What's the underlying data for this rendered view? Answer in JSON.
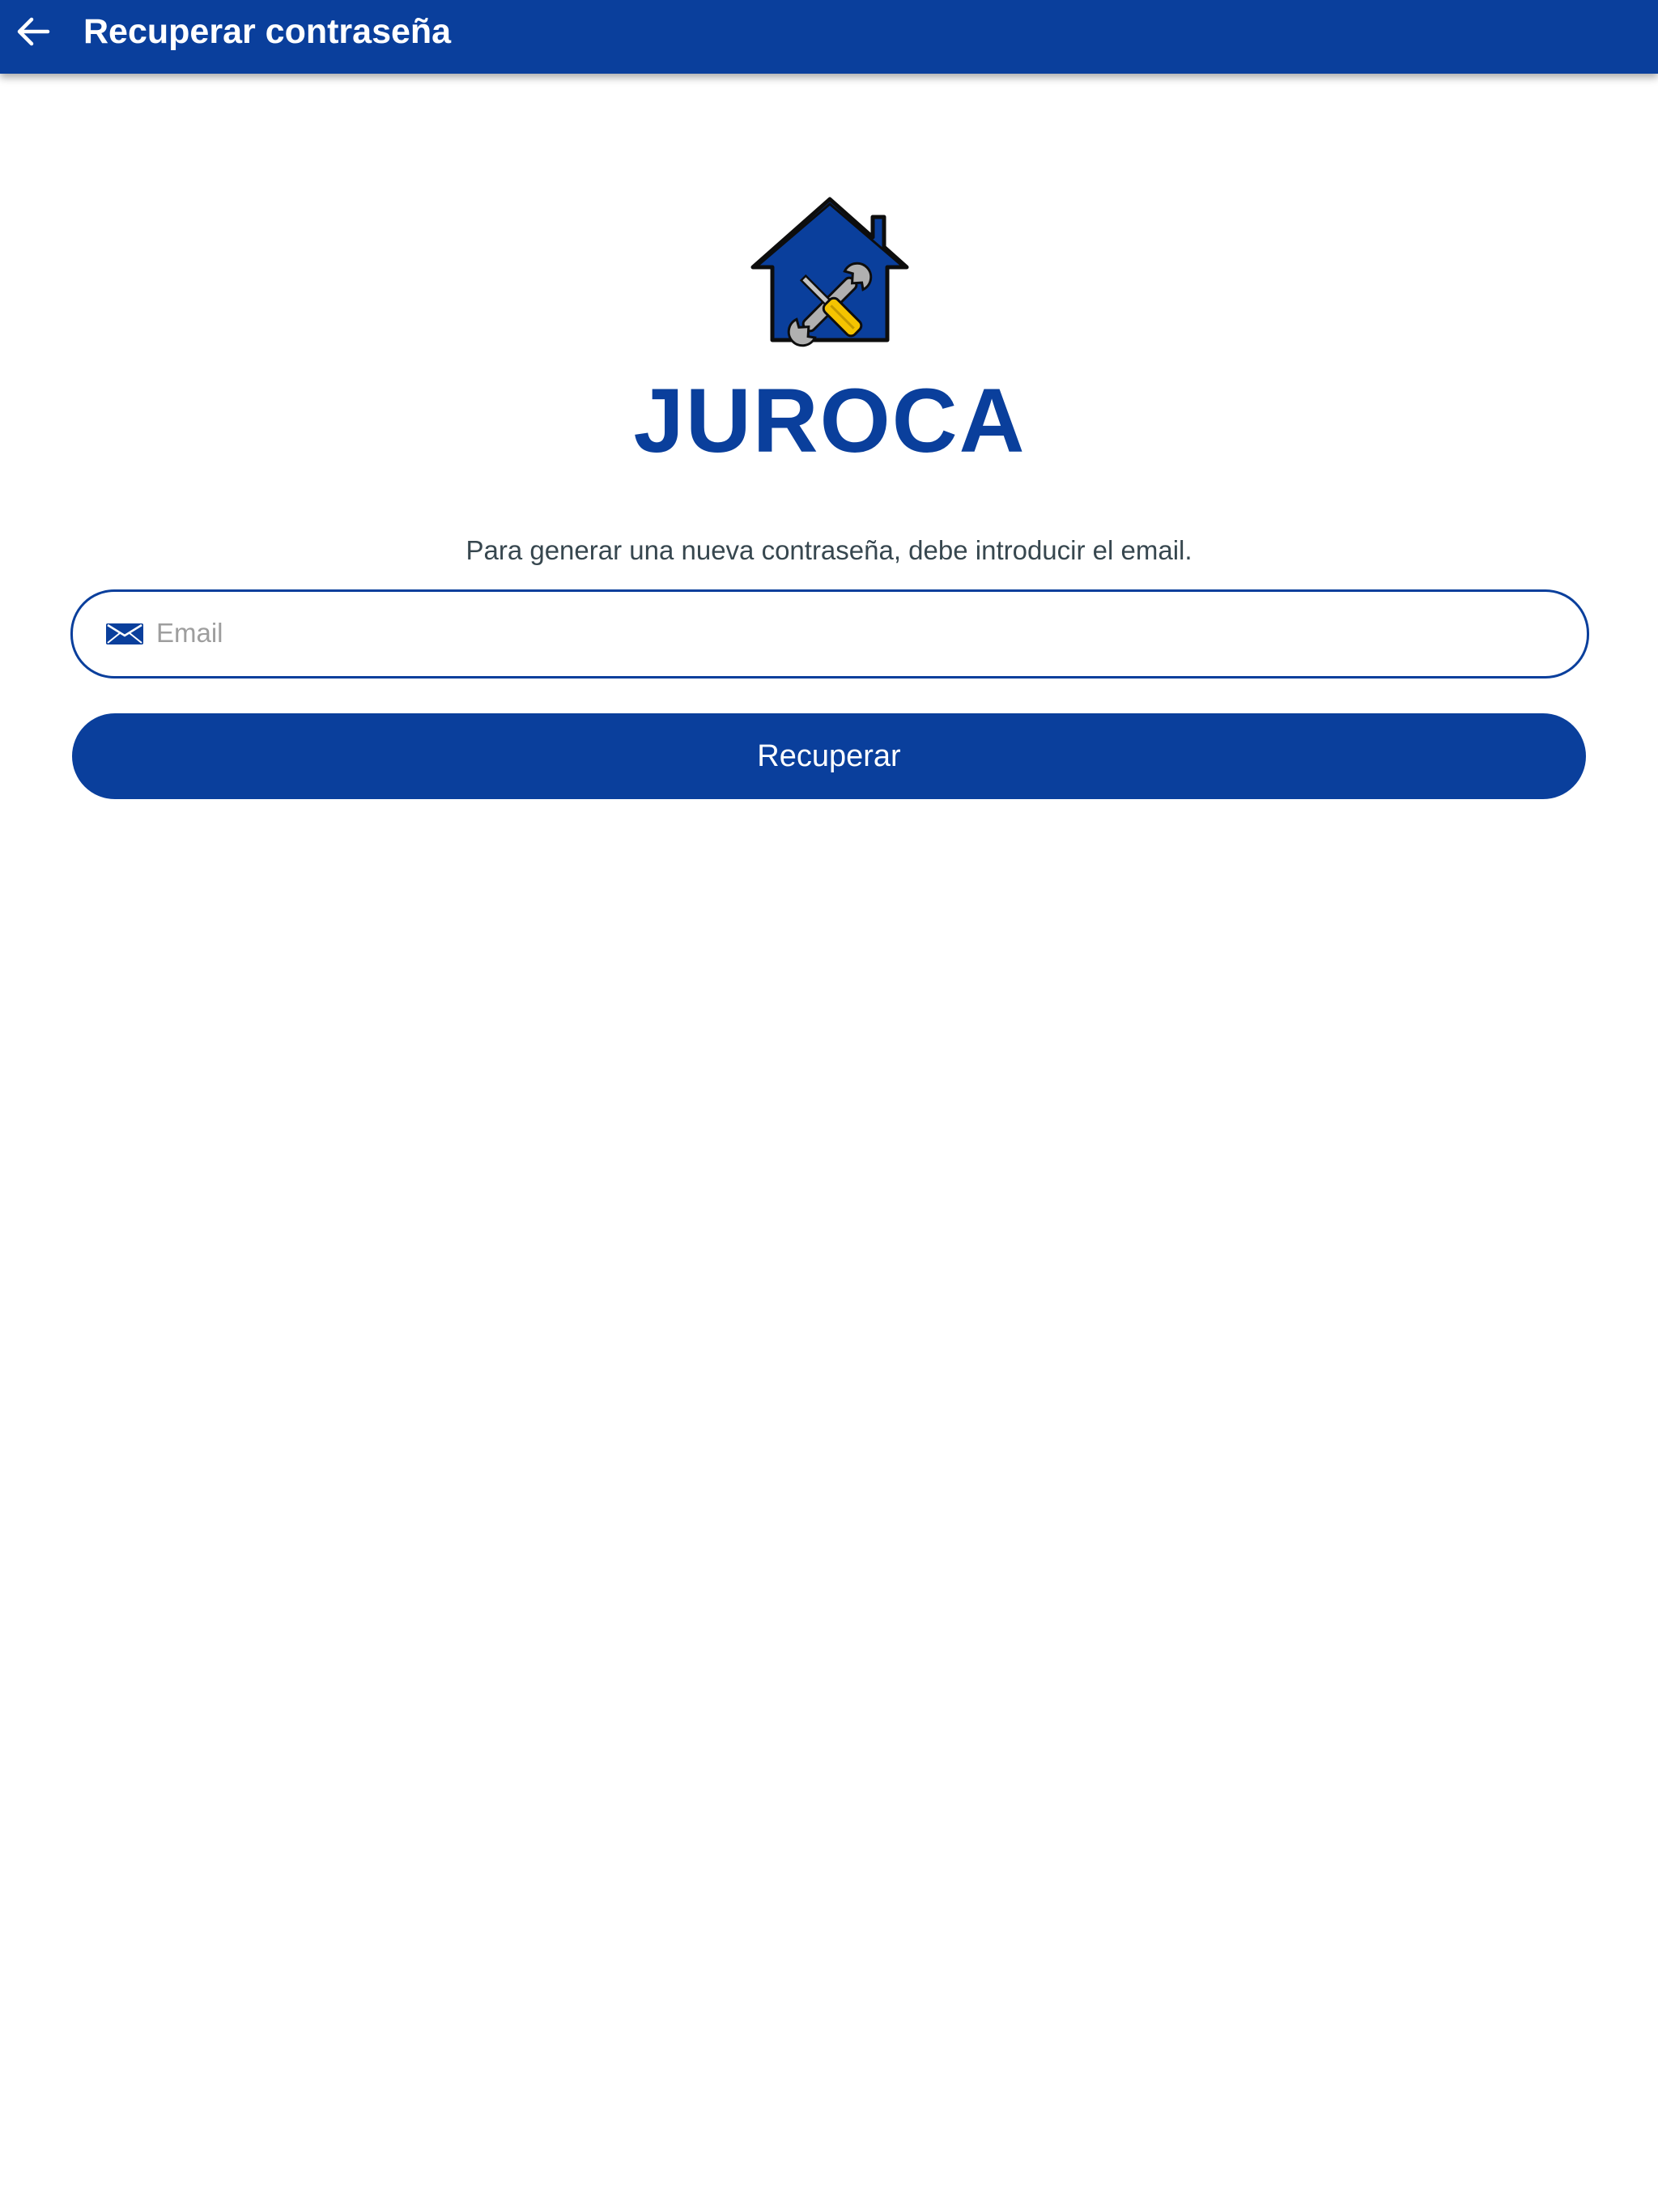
{
  "appbar": {
    "back_icon": "arrow-left-icon",
    "title": "Recuperar contraseña"
  },
  "logo": {
    "text": "JUROCA",
    "icon": "house-tools-icon"
  },
  "form": {
    "instructions": "Para generar una nueva contraseña, debe introducir el email.",
    "email": {
      "icon": "envelope-icon",
      "placeholder": "Email",
      "value": ""
    },
    "submit_label": "Recuperar"
  },
  "colors": {
    "primary": "#0a3f9c",
    "text_muted": "#37474f",
    "placeholder": "#9e9e9e",
    "tool_yellow": "#f5c400",
    "tool_gray": "#a8a8a8"
  }
}
